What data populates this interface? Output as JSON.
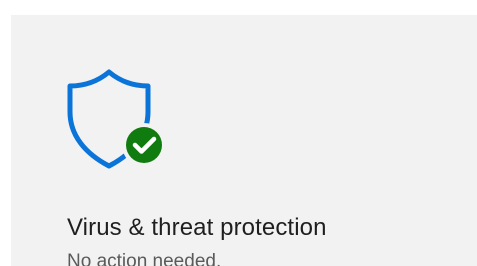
{
  "tile": {
    "icon": "shield-check-icon",
    "title": "Virus & threat protection",
    "status": "No action needed."
  },
  "colors": {
    "background": "#ffffff",
    "tile_background": "#f2f2f2",
    "shield_stroke": "#0a74d8",
    "check_badge": "#107c10",
    "title_text": "#1f1f1f",
    "status_text": "#5a5a5a"
  }
}
